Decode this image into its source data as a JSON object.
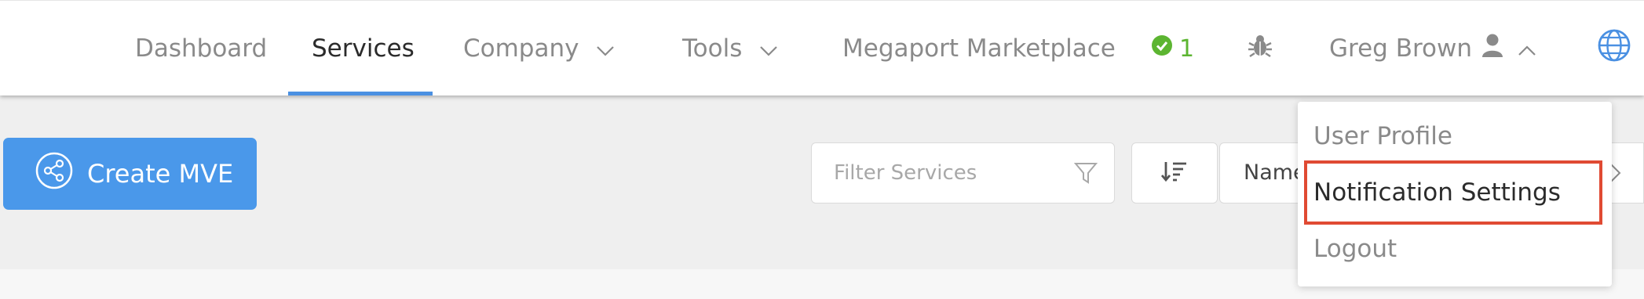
{
  "nav": {
    "dashboard": "Dashboard",
    "services": "Services",
    "company": "Company",
    "tools": "Tools",
    "marketplace": "Megaport Marketplace"
  },
  "status": {
    "count": "1",
    "color": "#5cb531"
  },
  "user": {
    "name": "Greg Brown"
  },
  "toolbar": {
    "create_label": "Create MVE",
    "filter_placeholder": "Filter Services",
    "sort_value": "Name"
  },
  "user_menu": {
    "items": [
      "User Profile",
      "Notification Settings",
      "Logout"
    ],
    "highlighted": "Notification Settings"
  },
  "colors": {
    "accent": "#4a90e2",
    "button": "#4a98ea",
    "highlight": "#e04a33"
  },
  "icons": [
    "chevron-down-icon",
    "check-circle-icon",
    "bug-icon",
    "user-icon",
    "chevron-up-icon",
    "globe-icon",
    "share-icon",
    "filter-icon",
    "sort-icon"
  ]
}
